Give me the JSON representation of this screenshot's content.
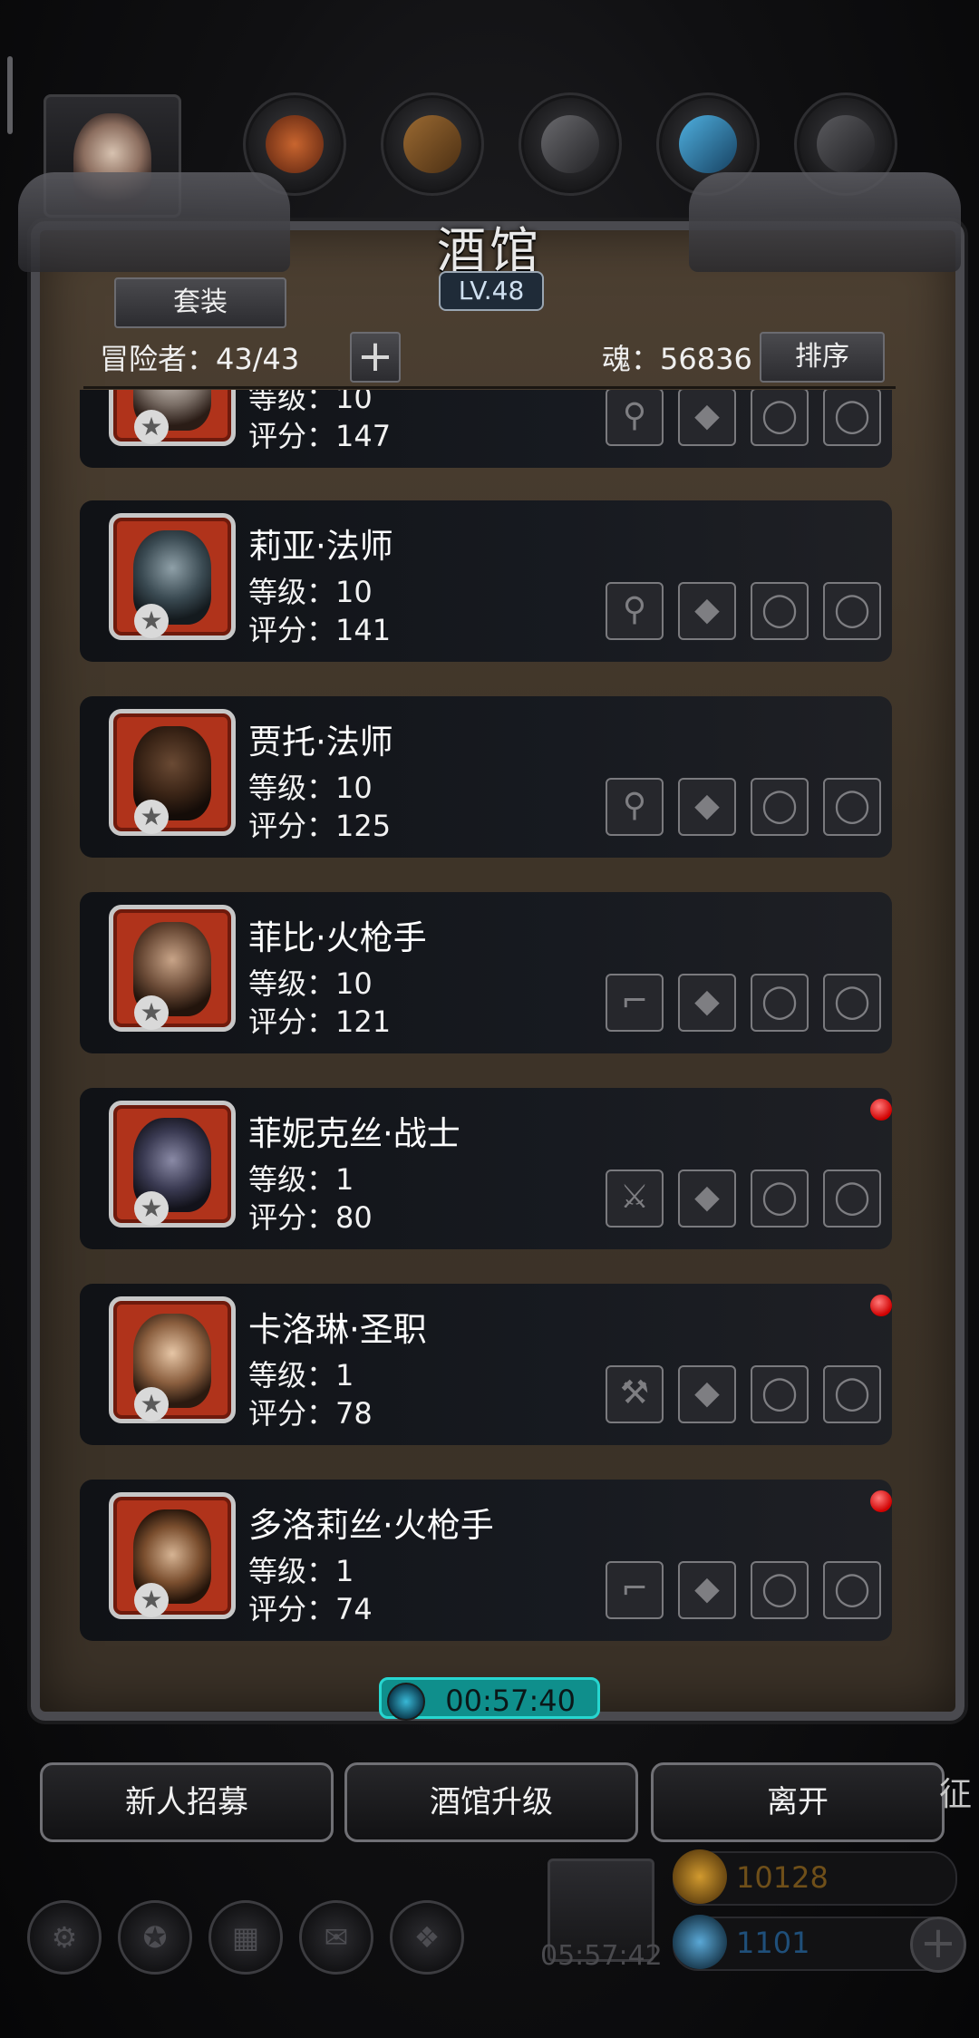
{
  "title": "酒馆",
  "level_badge": "LV.48",
  "header": {
    "suit_button": "套装",
    "adventurers": "冒险者：43/43",
    "add_button": "+",
    "soul": "魂：56836",
    "sort_button": "排序"
  },
  "heroes": [
    {
      "name": "",
      "level": "等级：10",
      "score": "评分：147",
      "new": false,
      "weapon": "staff"
    },
    {
      "name": "莉亚·法师",
      "level": "等级：10",
      "score": "评分：141",
      "new": false,
      "weapon": "staff"
    },
    {
      "name": "贾托·法师",
      "level": "等级：10",
      "score": "评分：125",
      "new": false,
      "weapon": "staff"
    },
    {
      "name": "菲比·火枪手",
      "level": "等级：10",
      "score": "评分：121",
      "new": false,
      "weapon": "gun"
    },
    {
      "name": "菲妮克丝·战士",
      "level": "等级：1",
      "score": "评分：80",
      "new": true,
      "weapon": "sword"
    },
    {
      "name": "卡洛琳·圣职",
      "level": "等级：1",
      "score": "评分：78",
      "new": true,
      "weapon": "hammer"
    },
    {
      "name": "多洛莉丝·火枪手",
      "level": "等级：1",
      "score": "评分：74",
      "new": true,
      "weapon": "gun"
    }
  ],
  "timer": "00:57:40",
  "bottom_buttons": {
    "recruit": "新人招募",
    "upgrade": "酒馆升级",
    "leave": "离开"
  },
  "gift_timer": "05:57:42",
  "currency": {
    "gold": "10128",
    "gems": "1101"
  },
  "edge_text": "征",
  "colors": {
    "accent_teal": "#0f8f8c",
    "portrait_red": "#b0331b",
    "new_dot": "#d00000"
  }
}
